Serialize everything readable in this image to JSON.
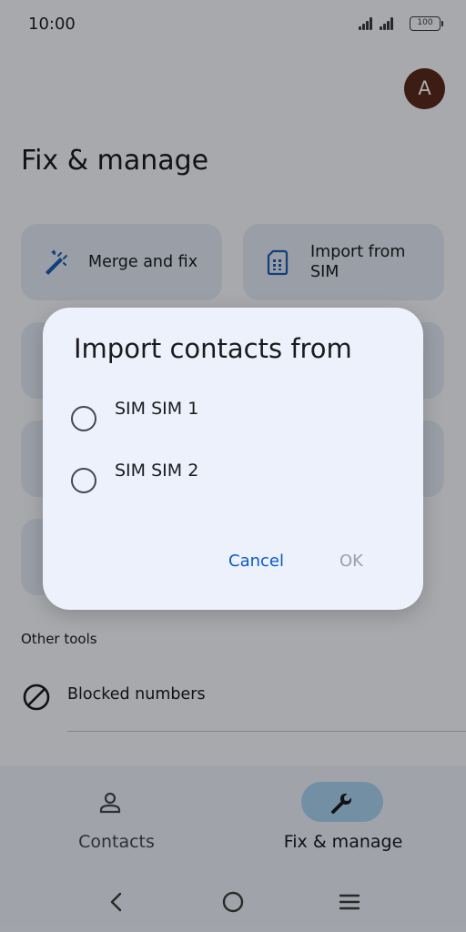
{
  "status_bar": {
    "time": "10:00",
    "battery": "100",
    "icons": [
      "signal-icon",
      "signal-icon",
      "battery-icon"
    ]
  },
  "header": {
    "avatar_letter": "A",
    "title": "Fix & manage"
  },
  "cards": {
    "merge": {
      "label": "Merge and fix",
      "icon": "magic-wand-icon"
    },
    "import": {
      "label": "Import from SIM",
      "icon": "sim-card-icon"
    }
  },
  "other_tools": {
    "section_label": "Other tools",
    "blocked_numbers": {
      "label": "Blocked numbers",
      "icon": "block-icon"
    }
  },
  "bottom_nav": {
    "items": [
      {
        "label": "Contacts",
        "icon": "person-icon",
        "selected": false
      },
      {
        "label": "Fix & manage",
        "icon": "wrench-icon",
        "selected": true
      }
    ]
  },
  "dialog": {
    "title": "Import contacts from",
    "options": [
      {
        "label": "SIM SIM 1",
        "selected": false
      },
      {
        "label": "SIM SIM 2",
        "selected": false
      }
    ],
    "cancel_label": "Cancel",
    "ok_label": "OK",
    "ok_enabled": false
  },
  "colors": {
    "accent": "#0b57d0",
    "avatar_bg": "#5b2a1e",
    "nav_selected_pill": "#a9d3f1",
    "card_bg": "#e3e9f6",
    "dialog_bg": "#edf1fc"
  }
}
